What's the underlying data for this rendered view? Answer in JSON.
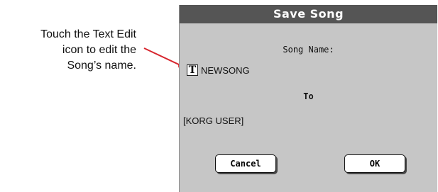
{
  "callout": {
    "lines": [
      "Touch the Text Edit",
      "icon to edit the",
      "Song’s name."
    ],
    "accent_color": "#d7262e"
  },
  "dialog": {
    "title": "Save Song",
    "song_name_label": "Song Name:",
    "text_edit_icon": "T",
    "song_name_value": "NEWSONG",
    "to_label": "To",
    "destination": "[KORG USER]",
    "cancel_label": "Cancel",
    "ok_label": "OK",
    "colors": {
      "title_bar": "#555555",
      "body": "#c6c6c6"
    }
  }
}
